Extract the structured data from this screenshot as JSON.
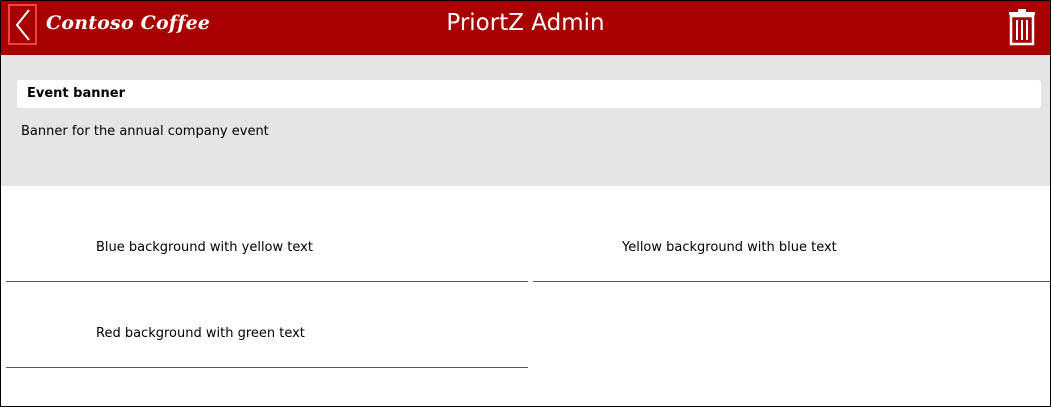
{
  "header": {
    "brand": "Contoso Coffee",
    "title": "PriortZ Admin",
    "back_icon": "chevron-left-icon",
    "delete_icon": "trash-icon"
  },
  "event": {
    "name": "Event banner",
    "description": "Banner for the annual company event"
  },
  "styles": [
    {
      "label": "Blue background with yellow text"
    },
    {
      "label": "Yellow background with blue text"
    },
    {
      "label": "Red background with green text"
    }
  ],
  "colors": {
    "header_bg": "#a80000",
    "accent_border": "#e8473f",
    "separator": "#4b55a0",
    "banner_bg": "#e5e5e5"
  }
}
